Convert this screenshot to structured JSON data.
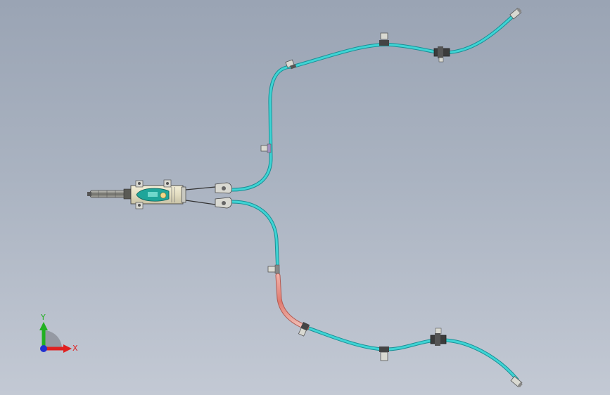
{
  "triad": {
    "x_label": "X",
    "y_label": "Y",
    "x_color": "#e02020",
    "y_color": "#22b022",
    "z_color": "#2030d0"
  },
  "colors": {
    "hose": "#3fd4d4",
    "hose_edge": "#1a8f96",
    "hose_red": "#e07a6e",
    "clip": "#d9d9d2",
    "metal": "#8d8d88",
    "background_top": "#9aa4b4",
    "background_bottom": "#c3c9d4"
  },
  "model": {
    "icons": [
      "brake-hose-assembly",
      "coordinate-triad-icon"
    ]
  }
}
